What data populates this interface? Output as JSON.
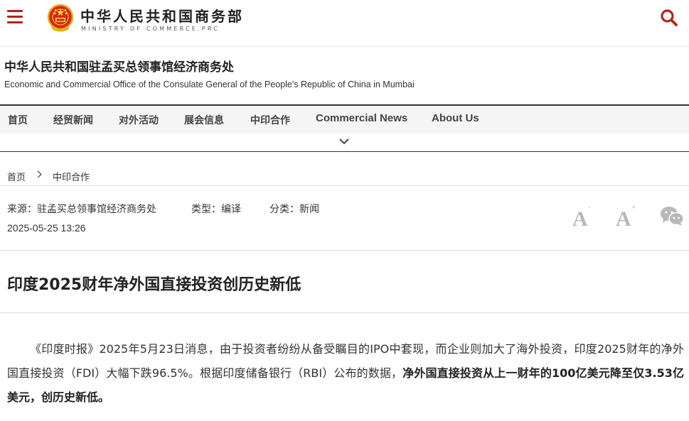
{
  "header": {
    "logo_cn": "中华人民共和国商务部",
    "logo_en": "MINISTRY OF COMMERCE.PRC",
    "menu_icon": "hamburger-menu-icon",
    "search_icon": "search-icon",
    "brand_color": "#b3241b"
  },
  "office": {
    "name_cn": "中华人民共和国驻孟买总领事馆经济商务处",
    "name_en": "Economic and Commercial Office of the Consulate General of the People's Republic of China in Mumbai"
  },
  "nav": {
    "items": [
      "首页",
      "经贸新闻",
      "对外活动",
      "展会信息",
      "中印合作",
      "Commercial News",
      "About Us"
    ],
    "expand_icon": "chevron-down-icon"
  },
  "breadcrumb": {
    "home": "首页",
    "current": "中印合作"
  },
  "meta": {
    "source": "来源：驻孟买总领事馆经济商务处",
    "type": "类型：编译",
    "category": "分类：新闻",
    "datetime": "2025-05-25 13:26",
    "font_decrease": "A",
    "font_decrease_mark": "-",
    "font_increase": "A",
    "font_increase_mark": "+",
    "share_icon": "wechat-icon"
  },
  "article": {
    "title": "印度2025财年净外国直接投资创历史新低",
    "body_plain": "《印度时报》2025年5月23日消息，由于投资者纷纷从备受瞩目的IPO中套现，而企业则加大了海外投资，印度2025财年的净外国直接投资（FDI）大幅下跌96.5%。根据印度储备银行（RBI）公布的数据，",
    "body_bold": "净外国直接投资从上一财年的100亿美元降至仅3.53亿美元，创历史新低。"
  }
}
